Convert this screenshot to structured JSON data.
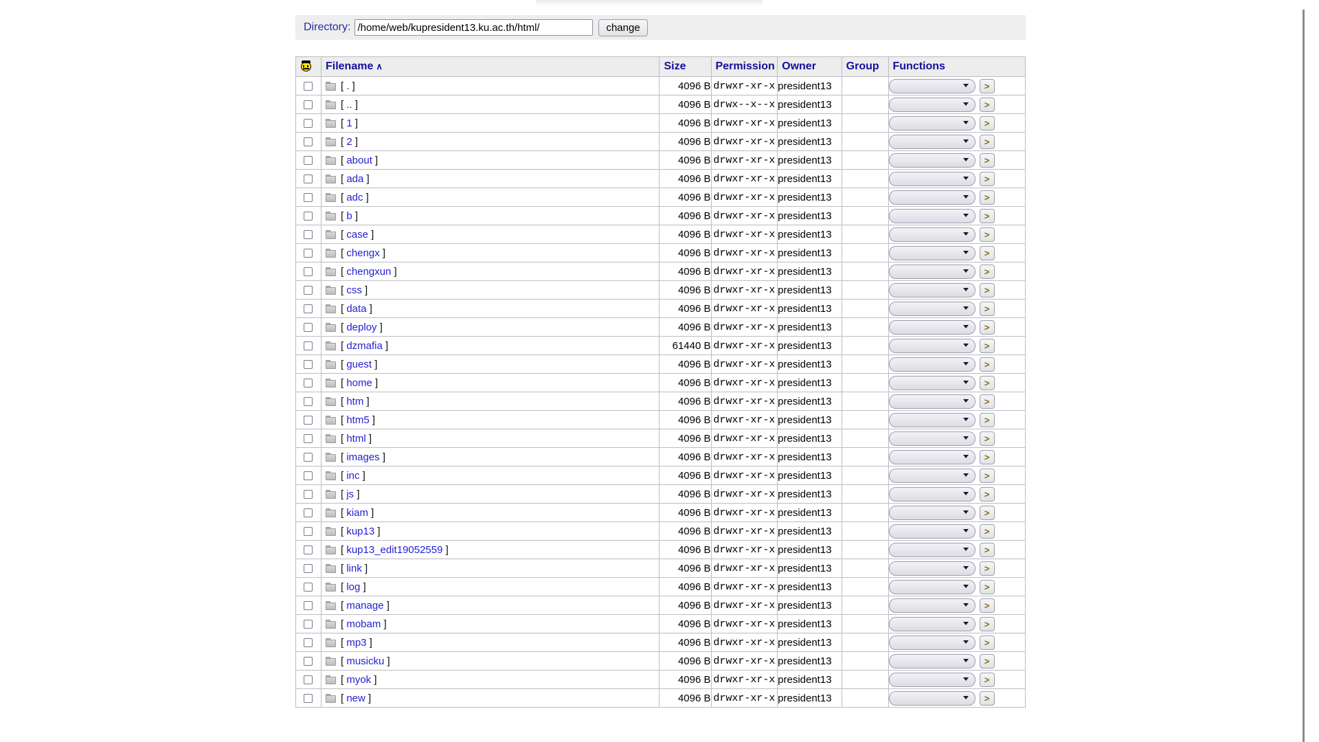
{
  "directory_bar": {
    "label": "Directory:",
    "path_value": "/home/web/kupresident13.ku.ac.th/html/",
    "path_placeholder": "",
    "change_label": "change"
  },
  "table": {
    "header_icon": "smiley-face-icon",
    "columns": {
      "checkbox": "",
      "filename": "Filename",
      "sort_indicator": "∧",
      "size": "Size",
      "permission": "Permission",
      "owner": "Owner",
      "group": "Group",
      "functions": "Functions"
    },
    "row_controls": {
      "select_value": "",
      "go_label": ">"
    },
    "rows": [
      {
        "name": ".",
        "size": "4096 B",
        "permission": "drwxr-xr-x",
        "owner": "president13",
        "group": ""
      },
      {
        "name": "..",
        "size": "4096 B",
        "permission": "drwx--x--x",
        "owner": "president13",
        "group": ""
      },
      {
        "name": "1",
        "size": "4096 B",
        "permission": "drwxr-xr-x",
        "owner": "president13",
        "group": ""
      },
      {
        "name": "2",
        "size": "4096 B",
        "permission": "drwxr-xr-x",
        "owner": "president13",
        "group": ""
      },
      {
        "name": "about",
        "size": "4096 B",
        "permission": "drwxr-xr-x",
        "owner": "president13",
        "group": ""
      },
      {
        "name": "ada",
        "size": "4096 B",
        "permission": "drwxr-xr-x",
        "owner": "president13",
        "group": ""
      },
      {
        "name": "adc",
        "size": "4096 B",
        "permission": "drwxr-xr-x",
        "owner": "president13",
        "group": ""
      },
      {
        "name": "b",
        "size": "4096 B",
        "permission": "drwxr-xr-x",
        "owner": "president13",
        "group": ""
      },
      {
        "name": "case",
        "size": "4096 B",
        "permission": "drwxr-xr-x",
        "owner": "president13",
        "group": ""
      },
      {
        "name": "chengx",
        "size": "4096 B",
        "permission": "drwxr-xr-x",
        "owner": "president13",
        "group": ""
      },
      {
        "name": "chengxun",
        "size": "4096 B",
        "permission": "drwxr-xr-x",
        "owner": "president13",
        "group": ""
      },
      {
        "name": "css",
        "size": "4096 B",
        "permission": "drwxr-xr-x",
        "owner": "president13",
        "group": ""
      },
      {
        "name": "data",
        "size": "4096 B",
        "permission": "drwxr-xr-x",
        "owner": "president13",
        "group": ""
      },
      {
        "name": "deploy",
        "size": "4096 B",
        "permission": "drwxr-xr-x",
        "owner": "president13",
        "group": ""
      },
      {
        "name": "dzmafia",
        "size": "61440 B",
        "permission": "drwxr-xr-x",
        "owner": "president13",
        "group": ""
      },
      {
        "name": "guest",
        "size": "4096 B",
        "permission": "drwxr-xr-x",
        "owner": "president13",
        "group": ""
      },
      {
        "name": "home",
        "size": "4096 B",
        "permission": "drwxr-xr-x",
        "owner": "president13",
        "group": ""
      },
      {
        "name": "htm",
        "size": "4096 B",
        "permission": "drwxr-xr-x",
        "owner": "president13",
        "group": ""
      },
      {
        "name": "htm5",
        "size": "4096 B",
        "permission": "drwxr-xr-x",
        "owner": "president13",
        "group": ""
      },
      {
        "name": "html",
        "size": "4096 B",
        "permission": "drwxr-xr-x",
        "owner": "president13",
        "group": ""
      },
      {
        "name": "images",
        "size": "4096 B",
        "permission": "drwxr-xr-x",
        "owner": "president13",
        "group": ""
      },
      {
        "name": "inc",
        "size": "4096 B",
        "permission": "drwxr-xr-x",
        "owner": "president13",
        "group": ""
      },
      {
        "name": "js",
        "size": "4096 B",
        "permission": "drwxr-xr-x",
        "owner": "president13",
        "group": ""
      },
      {
        "name": "kiam",
        "size": "4096 B",
        "permission": "drwxr-xr-x",
        "owner": "president13",
        "group": ""
      },
      {
        "name": "kup13",
        "size": "4096 B",
        "permission": "drwxr-xr-x",
        "owner": "president13",
        "group": ""
      },
      {
        "name": "kup13_edit19052559",
        "size": "4096 B",
        "permission": "drwxr-xr-x",
        "owner": "president13",
        "group": ""
      },
      {
        "name": "link",
        "size": "4096 B",
        "permission": "drwxr-xr-x",
        "owner": "president13",
        "group": ""
      },
      {
        "name": "log",
        "size": "4096 B",
        "permission": "drwxr-xr-x",
        "owner": "president13",
        "group": ""
      },
      {
        "name": "manage",
        "size": "4096 B",
        "permission": "drwxr-xr-x",
        "owner": "president13",
        "group": ""
      },
      {
        "name": "mobam",
        "size": "4096 B",
        "permission": "drwxr-xr-x",
        "owner": "president13",
        "group": ""
      },
      {
        "name": "mp3",
        "size": "4096 B",
        "permission": "drwxr-xr-x",
        "owner": "president13",
        "group": ""
      },
      {
        "name": "musicku",
        "size": "4096 B",
        "permission": "drwxr-xr-x",
        "owner": "president13",
        "group": ""
      },
      {
        "name": "myok",
        "size": "4096 B",
        "permission": "drwxr-xr-x",
        "owner": "president13",
        "group": ""
      },
      {
        "name": "new",
        "size": "4096 B",
        "permission": "drwxr-xr-x",
        "owner": "president13",
        "group": ""
      }
    ]
  },
  "colors": {
    "link": "#1f1fcf",
    "header_text": "#11119b",
    "bar_background": "#eeeeee",
    "header_background": "#ededed",
    "go_button_text": "#8a6a08"
  }
}
